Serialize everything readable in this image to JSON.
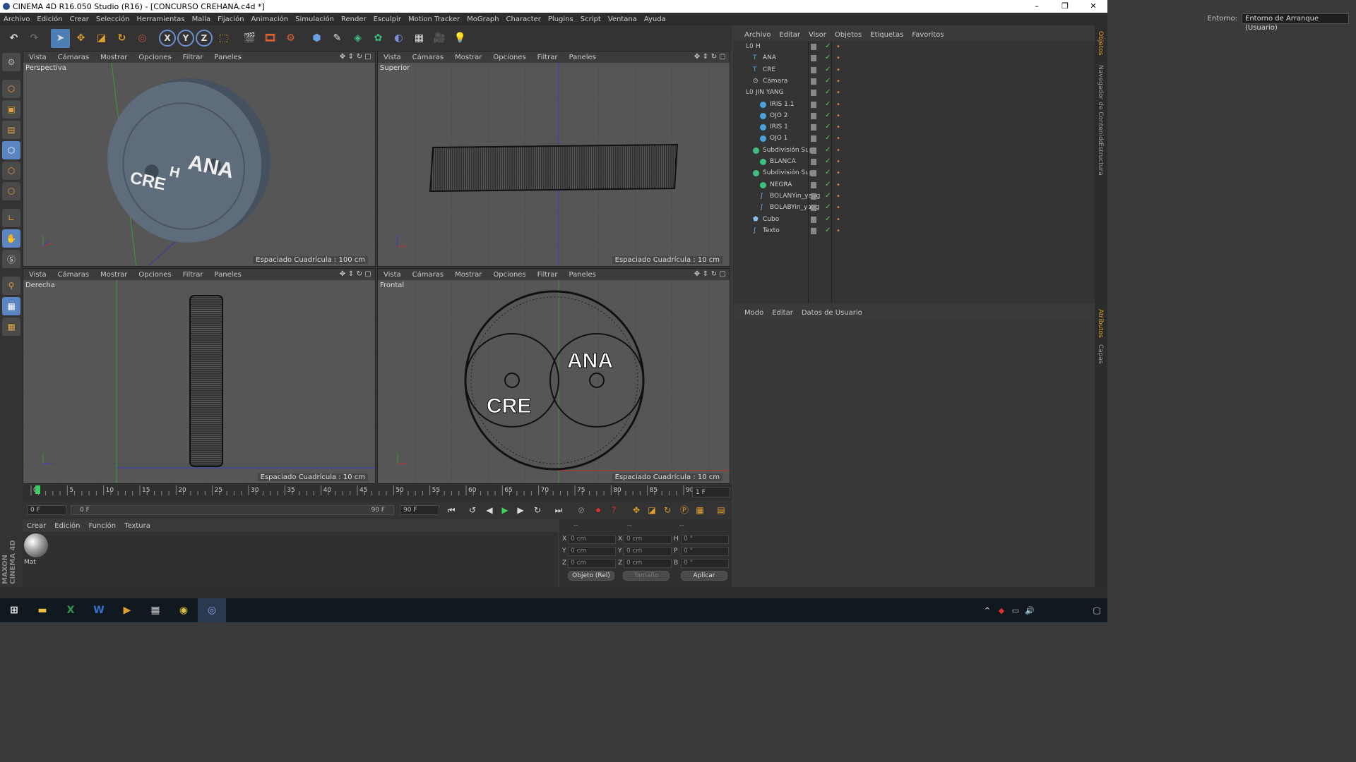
{
  "window": {
    "title": "CINEMA 4D R16.050 Studio (R16) - [CONCURSO CREHANA.c4d *]"
  },
  "menu": [
    "Archivo",
    "Edición",
    "Crear",
    "Selección",
    "Herramientas",
    "Malla",
    "Fijación",
    "Animación",
    "Simulación",
    "Render",
    "Esculpir",
    "Motion Tracker",
    "MoGraph",
    "Character",
    "Plugins",
    "Script",
    "Ventana",
    "Ayuda"
  ],
  "env": {
    "label": "Entorno:",
    "value": "Entorno de Arranque (Usuario)"
  },
  "toolbar_labels": {
    "x": "X",
    "y": "Y",
    "z": "Z"
  },
  "viewport_menu": [
    "Vista",
    "Cámaras",
    "Mostrar",
    "Opciones",
    "Filtrar",
    "Paneles"
  ],
  "viewports": [
    {
      "name": "Perspectiva",
      "grid": "Espaciado Cuadrícula : 100 cm"
    },
    {
      "name": "Superior",
      "grid": "Espaciado Cuadrícula : 10 cm"
    },
    {
      "name": "Derecha",
      "grid": "Espaciado Cuadrícula : 10 cm"
    },
    {
      "name": "Frontal",
      "grid": "Espaciado Cuadrícula : 10 cm"
    }
  ],
  "scene_text": {
    "ana": "ANA",
    "cre": "CRE",
    "h": "H"
  },
  "timeline": {
    "ticks": [
      "0",
      "5",
      "10",
      "15",
      "20",
      "25",
      "30",
      "35",
      "40",
      "45",
      "50",
      "55",
      "60",
      "65",
      "70",
      "75",
      "80",
      "85",
      "90"
    ],
    "current": "1 F",
    "start": "0 F",
    "range_start": "0 F",
    "range_end": "90 F",
    "end": "90 F"
  },
  "material_panel": {
    "menu": [
      "Crear",
      "Edición",
      "Función",
      "Textura"
    ],
    "material": "Mat"
  },
  "coords": {
    "header": [
      "--",
      "--",
      "--"
    ],
    "labels": [
      "X",
      "Y",
      "Z",
      "X",
      "Y",
      "Z",
      "H",
      "P",
      "B"
    ],
    "values": [
      "0 cm",
      "0 cm",
      "0 cm",
      "0 cm",
      "0 cm",
      "0 cm",
      "0 °",
      "0 °",
      "0 °"
    ],
    "mode": "Objeto (Rel)",
    "size": "Tamaño",
    "apply": "Aplicar"
  },
  "object_manager": {
    "menu": [
      "Archivo",
      "Editar",
      "Visor",
      "Objetos",
      "Etiquetas",
      "Favoritos"
    ],
    "objects": [
      {
        "name": "H",
        "indent": 0,
        "icon": "null"
      },
      {
        "name": "ANA",
        "indent": 1,
        "icon": "text"
      },
      {
        "name": "CRE",
        "indent": 1,
        "icon": "text"
      },
      {
        "name": "Cámara",
        "indent": 1,
        "icon": "camera"
      },
      {
        "name": "JIN YANG",
        "indent": 0,
        "icon": "null"
      },
      {
        "name": "IRIS 1.1",
        "indent": 2,
        "icon": "sphere"
      },
      {
        "name": "OJO 2",
        "indent": 2,
        "icon": "sphere"
      },
      {
        "name": "IRIS 1",
        "indent": 2,
        "icon": "sphere"
      },
      {
        "name": "OJO 1",
        "indent": 2,
        "icon": "sphere"
      },
      {
        "name": "Subdivisión Sup",
        "indent": 1,
        "icon": "subdiv"
      },
      {
        "name": "BLANCA",
        "indent": 2,
        "icon": "subdiv"
      },
      {
        "name": "Subdivisión Sup",
        "indent": 1,
        "icon": "subdiv"
      },
      {
        "name": "NEGRA",
        "indent": 2,
        "icon": "subdiv"
      },
      {
        "name": "BOLANYin_yang",
        "indent": 2,
        "icon": "spline"
      },
      {
        "name": "BOLABYin_yang",
        "indent": 2,
        "icon": "spline"
      },
      {
        "name": "Cubo",
        "indent": 1,
        "icon": "cube"
      },
      {
        "name": "Texto",
        "indent": 1,
        "icon": "spline"
      }
    ]
  },
  "attribute_manager": {
    "menu": [
      "Modo",
      "Editar",
      "Datos de Usuario"
    ]
  },
  "side_tabs": [
    "Objetos",
    "Navegador de Contenido",
    "Estructura",
    "Atributos",
    "Capas"
  ],
  "branding": "MAXON CINEMA 4D",
  "colors": {
    "accent": "#4d7fb5",
    "viewport": "#565656",
    "panel": "#343434",
    "tag": "#e08030",
    "check": "#55cc55"
  }
}
